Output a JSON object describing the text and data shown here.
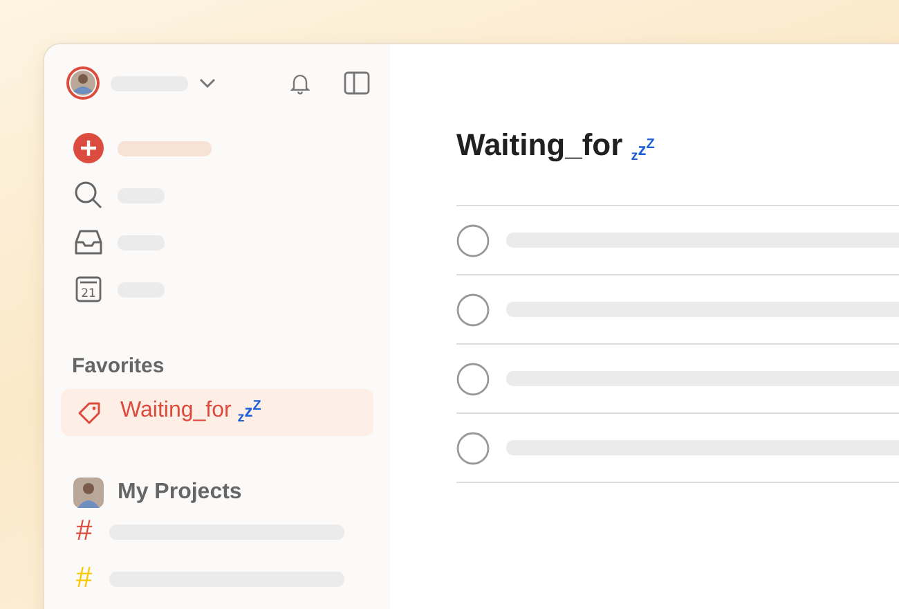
{
  "sidebar": {
    "calendar_day": "21",
    "favorites": {
      "heading": "Favorites",
      "items": [
        {
          "label": "Waiting_for",
          "mark": "$_{z}$z$^{Z}$",
          "selected": true
        }
      ]
    },
    "projects": {
      "heading": "My Projects",
      "items": [
        {
          "symbol": "#",
          "color": "#dc4c3e"
        },
        {
          "symbol": "#",
          "color": "#fac800"
        }
      ]
    }
  },
  "main": {
    "title": "Waiting_for",
    "mark": "$_{z}$z$^{Z}$",
    "tasks": [
      {
        "completed": false
      },
      {
        "completed": false
      },
      {
        "completed": false
      },
      {
        "completed": false
      }
    ]
  }
}
